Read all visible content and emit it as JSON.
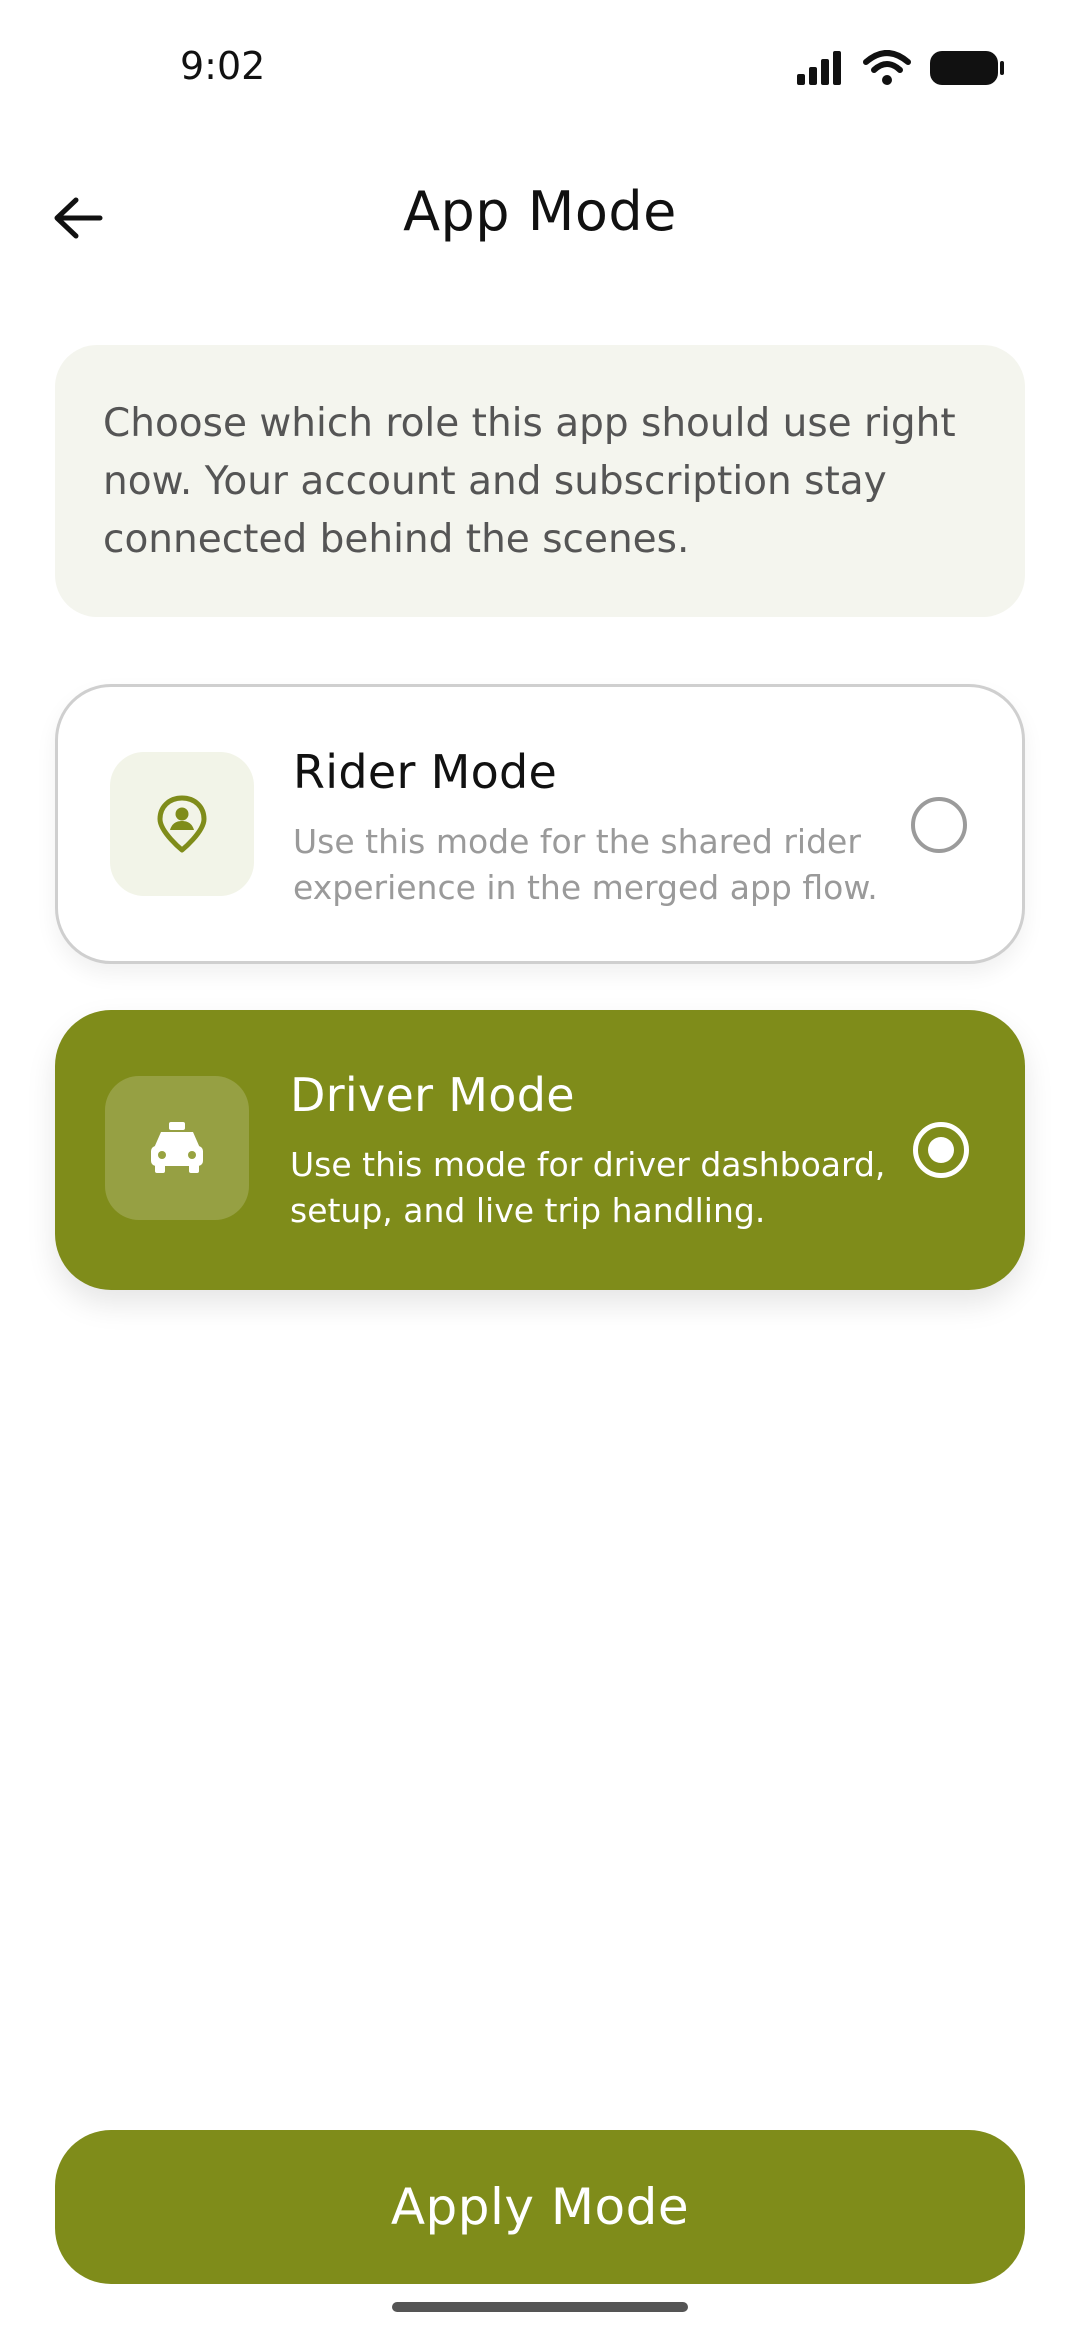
{
  "status_bar": {
    "time": "9:02",
    "icons": [
      "signal-icon",
      "wifi-icon",
      "battery-icon"
    ]
  },
  "header": {
    "title": "App Mode",
    "back_icon": "arrow-left-icon"
  },
  "info": {
    "text": "Choose which role this app should use right now. Your account and subscription stay connected behind the scenes."
  },
  "modes": [
    {
      "id": "rider",
      "title": "Rider Mode",
      "description": "Use this mode for the shared rider experience in the merged app flow.",
      "icon": "person-pin-icon",
      "selected": false
    },
    {
      "id": "driver",
      "title": "Driver Mode",
      "description": "Use this mode for driver dashboard, setup, and live trip handling.",
      "icon": "taxi-icon",
      "selected": true
    }
  ],
  "apply_button": {
    "label": "Apply Mode"
  },
  "colors": {
    "accent": "#7f8c1a",
    "info_bg": "#f4f5ee",
    "icon_bg": "#f2f4e8",
    "muted_text": "#9a9a9a"
  }
}
